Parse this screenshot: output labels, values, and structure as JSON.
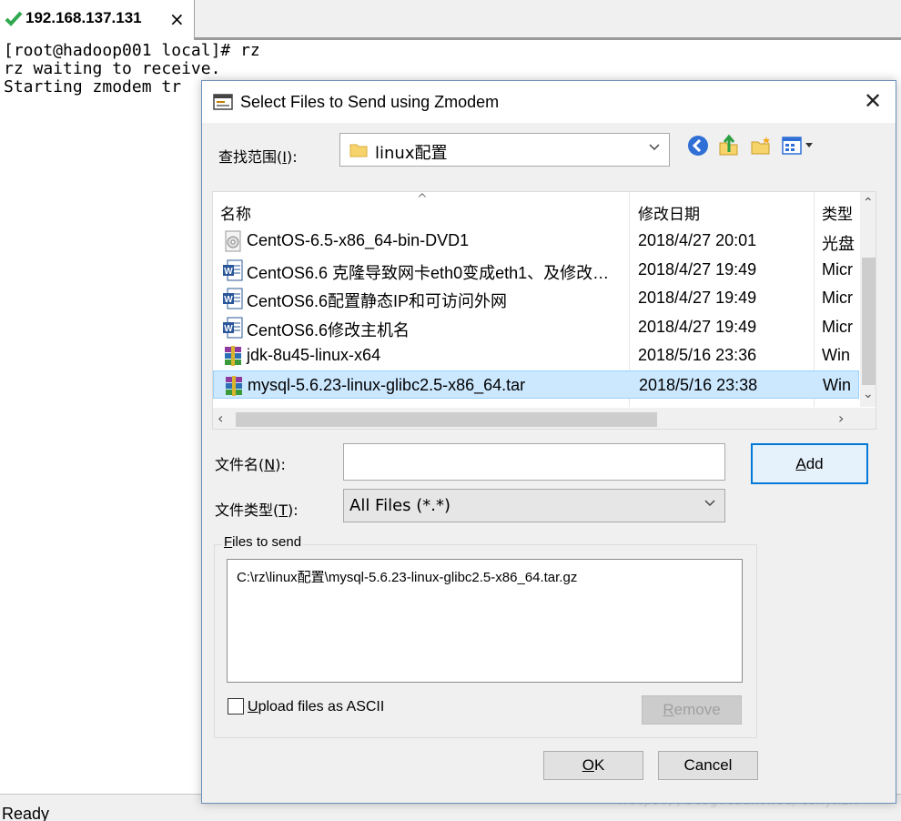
{
  "tab": {
    "title": "192.168.137.131",
    "close": "×"
  },
  "terminal": {
    "lines": [
      "[root@hadoop001 local]# rz",
      "rz waiting to receive.",
      "Starting zmodem tr"
    ]
  },
  "status": {
    "text": "Ready"
  },
  "watermark": "https://blog.csdn.net/tonyhzk",
  "dialog": {
    "title": "Select Files to Send using Zmodem",
    "close": "✕",
    "look_in_label_pre": "查找范围(",
    "look_in_label_key": "I",
    "look_in_label_post": "):",
    "look_in_value": "linux配置",
    "columns": {
      "name": "名称",
      "date": "修改日期",
      "type": "类型"
    },
    "files": [
      {
        "name": "CentOS-6.5-x86_64-bin-DVD1",
        "date": "2018/4/27 20:01",
        "type": "光盘",
        "icon": "disc-image-icon"
      },
      {
        "name": "CentOS6.6 克隆导致网卡eth0变成eth1、及修改…",
        "date": "2018/4/27 19:49",
        "type": "Micr",
        "icon": "word-doc-icon"
      },
      {
        "name": "CentOS6.6配置静态IP和可访问外网",
        "date": "2018/4/27 19:49",
        "type": "Micr",
        "icon": "word-doc-icon"
      },
      {
        "name": "CentOS6.6修改主机名",
        "date": "2018/4/27 19:49",
        "type": "Micr",
        "icon": "word-doc-icon"
      },
      {
        "name": "jdk-8u45-linux-x64",
        "date": "2018/5/16 23:36",
        "type": "Win",
        "icon": "winrar-archive-icon"
      },
      {
        "name": "mysql-5.6.23-linux-glibc2.5-x86_64.tar",
        "date": "2018/5/16 23:38",
        "type": "Win",
        "icon": "winrar-archive-icon",
        "selected": true
      }
    ],
    "filename_label_pre": "文件名(",
    "filename_label_key": "N",
    "filename_label_post": "):",
    "filename_value": "",
    "filetype_label_pre": "文件类型(",
    "filetype_label_key": "T",
    "filetype_label_post": "):",
    "filetype_value": "All Files (*.*)",
    "add_button_key": "A",
    "add_button_rest": "dd",
    "files_to_send_label_key": "F",
    "files_to_send_label_rest": "iles to send",
    "files_to_send": [
      "C:\\rz\\linux配置\\mysql-5.6.23-linux-glibc2.5-x86_64.tar.gz"
    ],
    "ascii_checkbox_key": "U",
    "ascii_checkbox_rest": "pload files as ASCII",
    "ascii_checked": false,
    "remove_button_key": "R",
    "remove_button_rest": "emove",
    "ok_button_key": "O",
    "ok_button_rest": "K",
    "cancel_button": "Cancel"
  },
  "colors": {
    "accent": "#0078d7",
    "selection": "#cce8ff",
    "check_green": "#2fa84f"
  }
}
